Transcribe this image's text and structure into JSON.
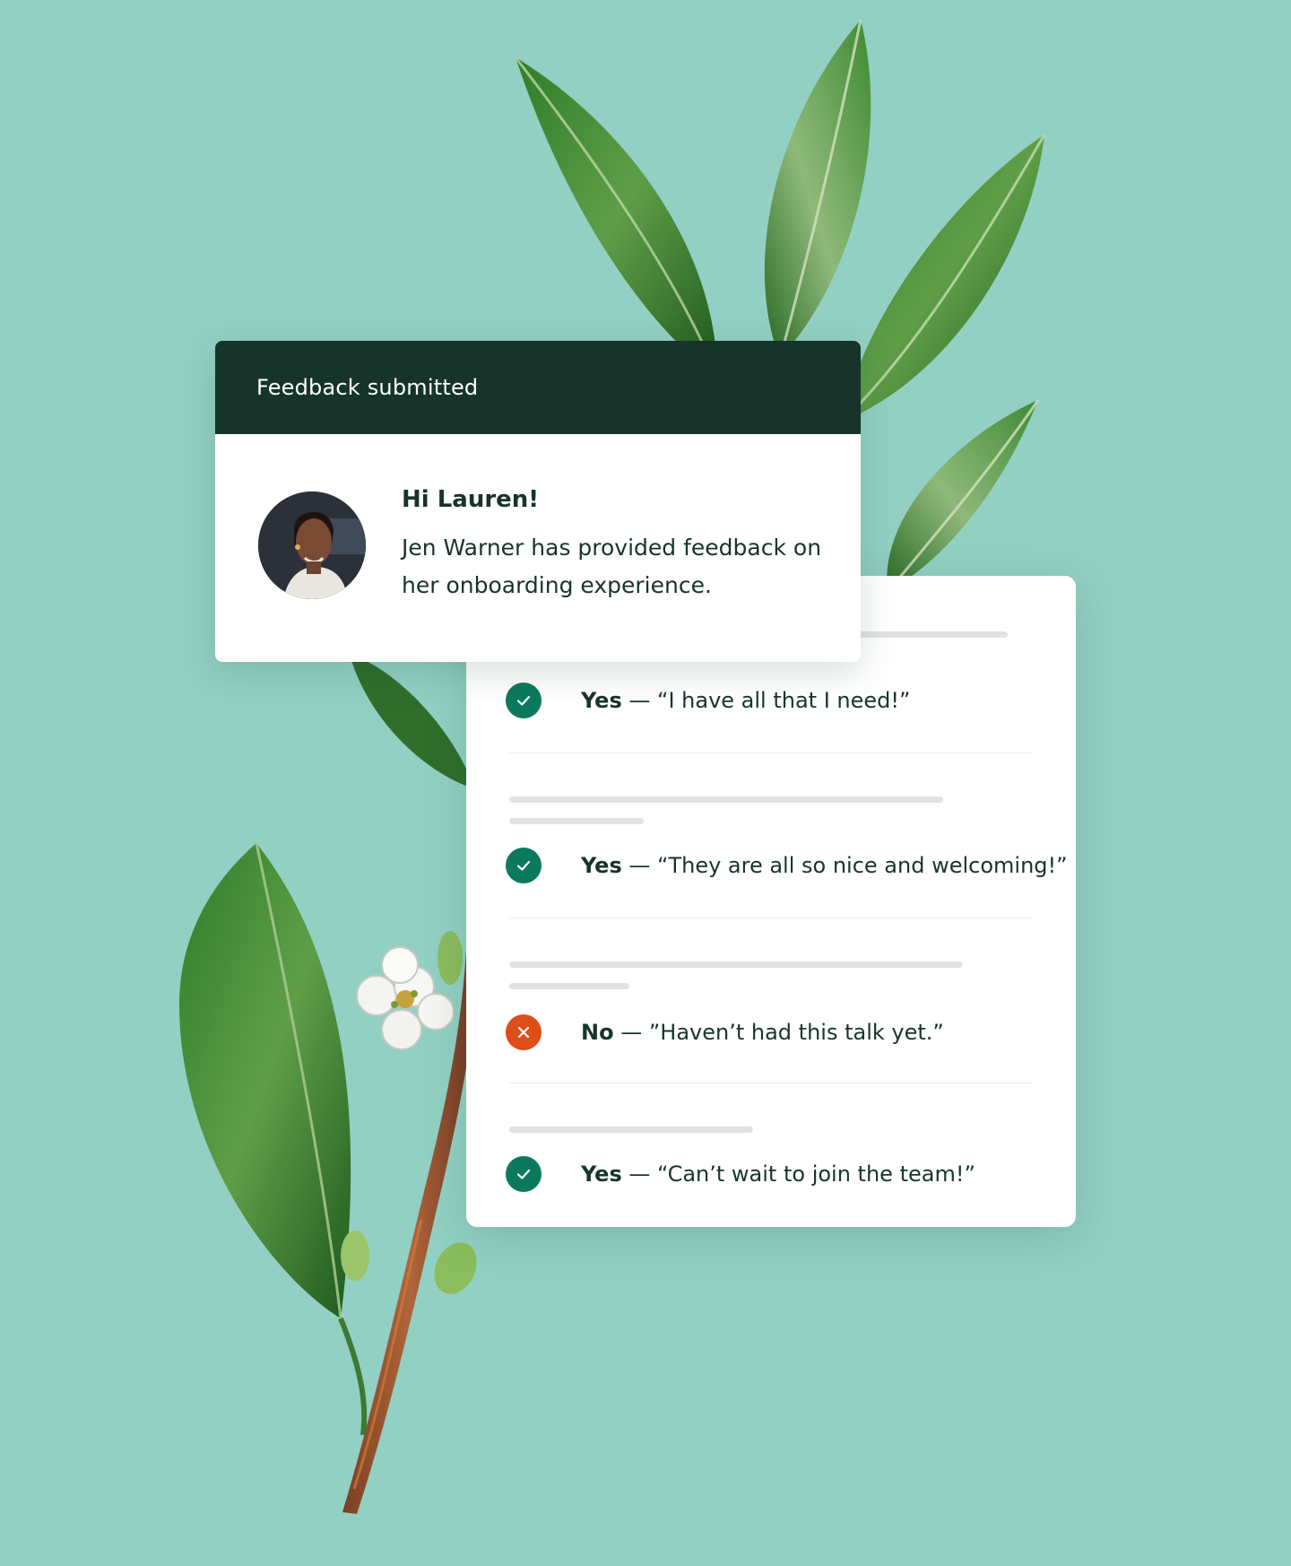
{
  "notification": {
    "header": "Feedback submitted",
    "greeting": "Hi Lauren!",
    "message": "Jen Warner has provided feedback on her onboarding experience.",
    "avatar_alt": "Jen Warner"
  },
  "answers": [
    {
      "status": "yes",
      "icon": "check-icon",
      "verdict": "Yes",
      "quote": " — “I have all that I need!”"
    },
    {
      "status": "yes",
      "icon": "check-icon",
      "verdict": "Yes",
      "quote": " — “They are all so nice and welcoming!”"
    },
    {
      "status": "no",
      "icon": "x-icon",
      "verdict": "No",
      "quote": " — ”Haven’t had this talk yet.”"
    },
    {
      "status": "yes",
      "icon": "check-icon",
      "verdict": "Yes",
      "quote": " — “Can’t wait to join the team!”"
    }
  ],
  "colors": {
    "background": "#92d0c3",
    "header_bg": "#17342b",
    "yes": "#0b7a5c",
    "no": "#dd4e18",
    "text": "#17352d"
  }
}
